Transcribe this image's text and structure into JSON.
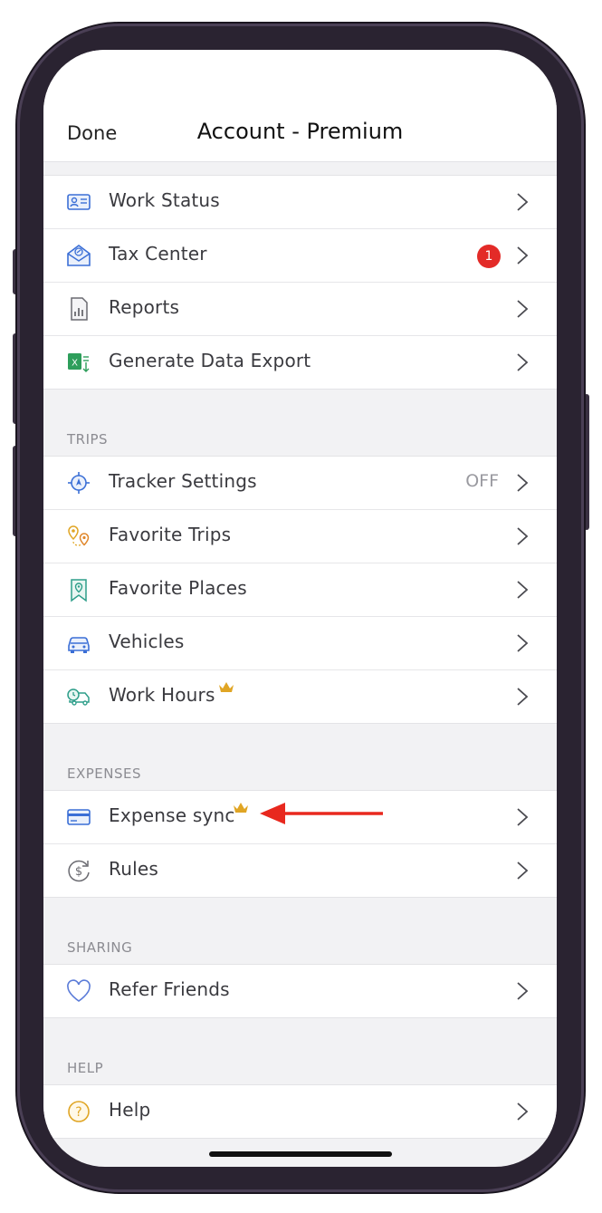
{
  "nav": {
    "done_label": "Done",
    "title": "Account - Premium"
  },
  "account_items": [
    {
      "label": "Work Status",
      "icon": "id-card-icon"
    },
    {
      "label": "Tax Center",
      "icon": "tax-envelope-icon",
      "badge": "1"
    },
    {
      "label": "Reports",
      "icon": "report-chart-icon"
    },
    {
      "label": "Generate Data Export",
      "icon": "excel-export-icon"
    }
  ],
  "sections": {
    "trips": {
      "header": "TRIPS"
    },
    "expenses": {
      "header": "EXPENSES"
    },
    "sharing": {
      "header": "SHARING"
    },
    "help": {
      "header": "HELP"
    }
  },
  "trips_items": [
    {
      "label": "Tracker Settings",
      "icon": "tracker-target-icon",
      "value": "OFF"
    },
    {
      "label": "Favorite Trips",
      "icon": "route-pins-icon"
    },
    {
      "label": "Favorite Places",
      "icon": "map-pin-icon"
    },
    {
      "label": "Vehicles",
      "icon": "car-icon"
    },
    {
      "label": "Work Hours",
      "icon": "clock-truck-icon",
      "premium": true
    }
  ],
  "expenses_items": [
    {
      "label": "Expense sync",
      "icon": "credit-card-icon",
      "premium": true
    },
    {
      "label": "Rules",
      "icon": "dollar-cycle-icon"
    }
  ],
  "sharing_items": [
    {
      "label": "Refer Friends",
      "icon": "heart-icon"
    }
  ],
  "help_items": [
    {
      "label": "Help",
      "icon": "question-circle-icon"
    }
  ],
  "colors": {
    "accent_blue": "#3b6fd6",
    "badge_red": "#e32b28",
    "crown_gold": "#e0a524",
    "arrow_red": "#e8281e"
  }
}
